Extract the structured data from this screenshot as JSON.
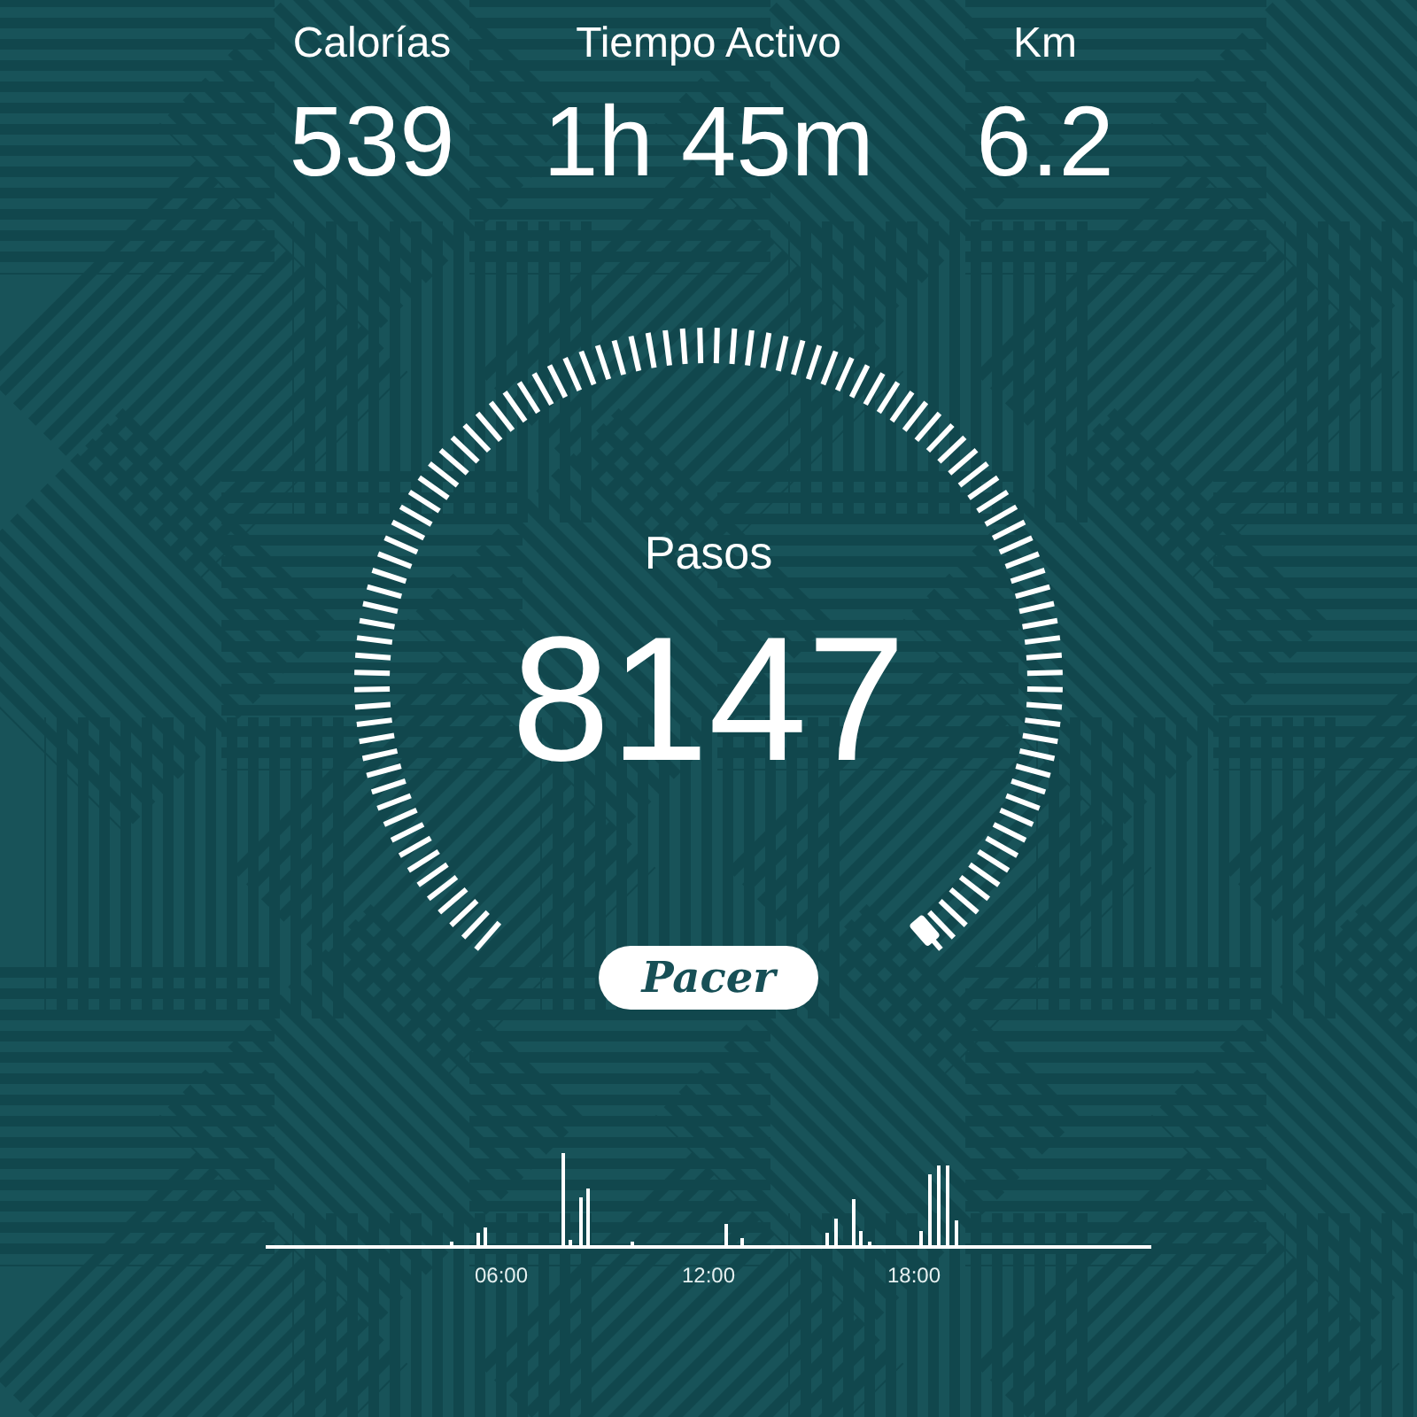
{
  "stats": [
    {
      "label": "Calorías",
      "value": "539"
    },
    {
      "label": "Tiempo Activo",
      "value": "1h 45m"
    },
    {
      "label": "Km",
      "value": "6.2"
    }
  ],
  "gauge": {
    "label": "Pasos",
    "value": "8147"
  },
  "logo": "Pacer",
  "activity_chart": {
    "x_labels": [
      "06:00",
      "12:00",
      "18:00"
    ]
  }
}
